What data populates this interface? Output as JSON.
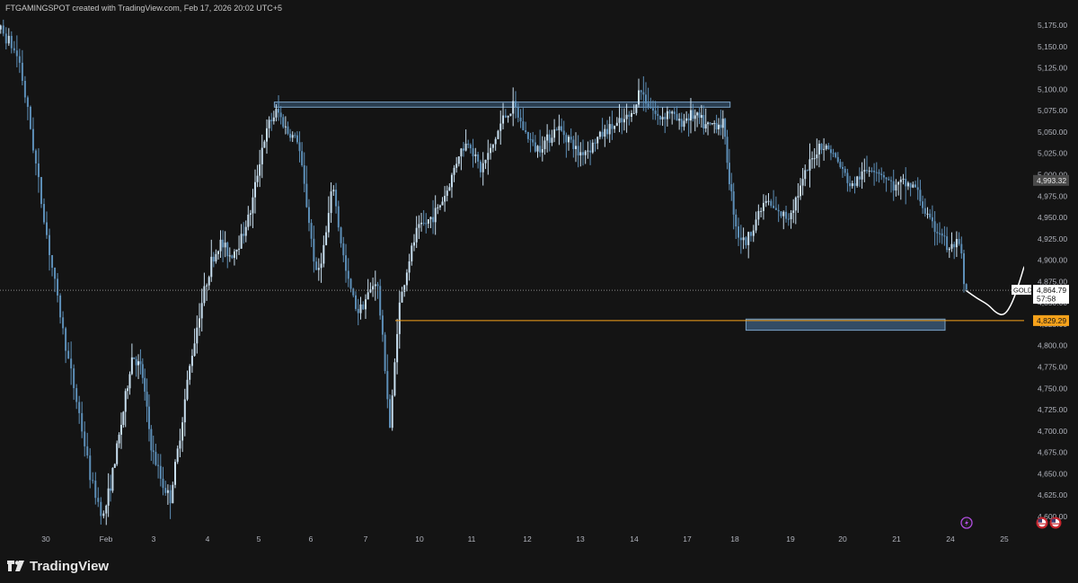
{
  "header": {
    "attribution": "FTGAMINGSPOT created with TradingView.com, Feb 17, 2026 20:02 UTC+5"
  },
  "footer": {
    "brand": "TradingView"
  },
  "colors": {
    "background": "#141414",
    "candle": "#c8dff0",
    "candle_dark": "#5d8fb8",
    "zone_fill": "#3d5f80",
    "zone_border": "#7aa3c8",
    "support_line": "#f7a21b",
    "projection": "#ffffff",
    "axis_text": "#b2b5be",
    "event_purple": "#b04ddf"
  },
  "chart_data": {
    "type": "candlestick",
    "symbol": "GOLD",
    "ylim": [
      4580,
      5195
    ],
    "y_ticks": [
      "5,175.00",
      "5,150.00",
      "5,125.00",
      "5,100.00",
      "5,075.00",
      "5,050.00",
      "5,025.00",
      "5,000.00",
      "4,975.00",
      "4,950.00",
      "4,925.00",
      "4,900.00",
      "4,875.00",
      "4,850.00",
      "4,825.00",
      "4,800.00",
      "4,775.00",
      "4,750.00",
      "4,725.00",
      "4,700.00",
      "4,675.00",
      "4,650.00",
      "4,625.00",
      "4,600.00"
    ],
    "x_labels": [
      "30",
      "Feb",
      "3",
      "4",
      "5",
      "6",
      "7",
      "10",
      "11",
      "12",
      "13",
      "14",
      "17",
      "18",
      "19",
      "20",
      "21",
      "24",
      "25"
    ],
    "price_tags": {
      "prev_label": "4,993.32",
      "prev_value": 4993.32,
      "symbol_label": "GOLD",
      "current_label": "4,864.79",
      "countdown": "57:58",
      "current_value": 4864.79,
      "support_label": "4,829.29",
      "support_value": 4829.29
    },
    "resistance_zone": {
      "from_x": 4.3,
      "to_x": 12.9,
      "low": 5079,
      "high": 5085
    },
    "support_zone": {
      "from_x": 13.2,
      "to_x": 16.9,
      "low": 4818,
      "high": 4831
    },
    "support_line_from_x": 6.55,
    "projection": [
      [
        17.3,
        4864
      ],
      [
        17.5,
        4855
      ],
      [
        17.7,
        4848
      ],
      [
        17.85,
        4838
      ],
      [
        18.0,
        4835
      ],
      [
        18.15,
        4850
      ],
      [
        18.3,
        4878
      ],
      [
        18.4,
        4900
      ],
      [
        18.55,
        4866
      ],
      [
        18.7,
        4895
      ],
      [
        18.85,
        4925
      ],
      [
        18.95,
        4950
      ],
      [
        19.05,
        4990
      ],
      [
        19.08,
        5030
      ]
    ],
    "events": [
      {
        "type": "lightning",
        "x": 17.3
      },
      {
        "type": "us-flag",
        "x": 18.7
      },
      {
        "type": "us-flag",
        "x": 18.95
      },
      {
        "type": "us-flag",
        "x": 20.7
      }
    ],
    "anchors": [
      [
        -1.2,
        5200
      ],
      [
        -0.9,
        5185
      ],
      [
        -0.6,
        5160
      ],
      [
        -0.4,
        5135
      ],
      [
        -0.2,
        5050
      ],
      [
        0.0,
        4955
      ],
      [
        0.2,
        4870
      ],
      [
        0.4,
        4790
      ],
      [
        0.6,
        4720
      ],
      [
        0.8,
        4640
      ],
      [
        1.0,
        4600
      ],
      [
        1.2,
        4655
      ],
      [
        1.4,
        4720
      ],
      [
        1.6,
        4790
      ],
      [
        1.8,
        4770
      ],
      [
        2.0,
        4680
      ],
      [
        2.2,
        4640
      ],
      [
        2.35,
        4620
      ],
      [
        2.5,
        4680
      ],
      [
        2.7,
        4770
      ],
      [
        2.9,
        4840
      ],
      [
        3.1,
        4895
      ],
      [
        3.3,
        4920
      ],
      [
        3.5,
        4905
      ],
      [
        3.7,
        4925
      ],
      [
        3.9,
        4960
      ],
      [
        4.1,
        5030
      ],
      [
        4.25,
        5060
      ],
      [
        4.4,
        5075
      ],
      [
        4.6,
        5050
      ],
      [
        4.8,
        5040
      ],
      [
        5.0,
        4950
      ],
      [
        5.15,
        4880
      ],
      [
        5.3,
        4920
      ],
      [
        5.45,
        4990
      ],
      [
        5.55,
        4940
      ],
      [
        5.7,
        4880
      ],
      [
        5.9,
        4840
      ],
      [
        6.1,
        4860
      ],
      [
        6.25,
        4880
      ],
      [
        6.4,
        4780
      ],
      [
        6.5,
        4700
      ],
      [
        6.65,
        4840
      ],
      [
        6.85,
        4900
      ],
      [
        7.0,
        4935
      ],
      [
        7.2,
        4945
      ],
      [
        7.4,
        4960
      ],
      [
        7.6,
        4985
      ],
      [
        7.8,
        5025
      ],
      [
        8.0,
        5040
      ],
      [
        8.2,
        5005
      ],
      [
        8.4,
        5030
      ],
      [
        8.6,
        5065
      ],
      [
        8.8,
        5080
      ],
      [
        9.0,
        5050
      ],
      [
        9.2,
        5030
      ],
      [
        9.4,
        5040
      ],
      [
        9.6,
        5055
      ],
      [
        9.8,
        5045
      ],
      [
        10.0,
        5025
      ],
      [
        10.2,
        5030
      ],
      [
        10.4,
        5045
      ],
      [
        10.6,
        5055
      ],
      [
        10.8,
        5060
      ],
      [
        11.0,
        5070
      ],
      [
        11.15,
        5100
      ],
      [
        11.3,
        5085
      ],
      [
        11.5,
        5065
      ],
      [
        11.7,
        5075
      ],
      [
        11.9,
        5060
      ],
      [
        12.1,
        5070
      ],
      [
        12.3,
        5065
      ],
      [
        12.45,
        5055
      ],
      [
        12.6,
        5060
      ],
      [
        12.8,
        5060
      ],
      [
        12.95,
        4985
      ],
      [
        13.1,
        4930
      ],
      [
        13.25,
        4920
      ],
      [
        13.4,
        4945
      ],
      [
        13.6,
        4970
      ],
      [
        13.8,
        4955
      ],
      [
        14.0,
        4950
      ],
      [
        14.2,
        4980
      ],
      [
        14.4,
        5010
      ],
      [
        14.6,
        5035
      ],
      [
        14.8,
        5030
      ],
      [
        15.0,
        5010
      ],
      [
        15.2,
        4985
      ],
      [
        15.4,
        5000
      ],
      [
        15.6,
        5010
      ],
      [
        15.8,
        5000
      ],
      [
        16.0,
        4985
      ],
      [
        16.2,
        4990
      ],
      [
        16.4,
        4985
      ],
      [
        16.55,
        4960
      ],
      [
        16.7,
        4940
      ],
      [
        16.9,
        4930
      ],
      [
        17.0,
        4910
      ],
      [
        17.15,
        4920
      ],
      [
        17.25,
        4905
      ],
      [
        17.3,
        4865
      ]
    ]
  }
}
